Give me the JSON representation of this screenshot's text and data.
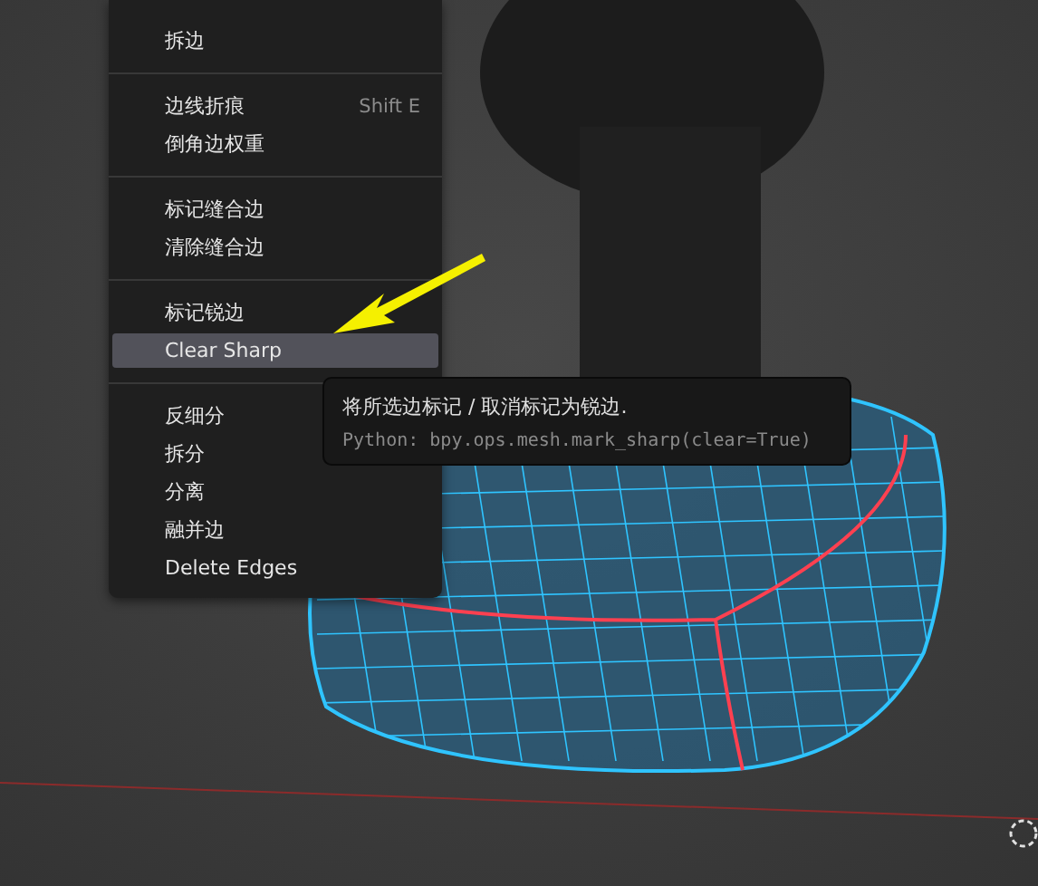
{
  "menu": {
    "items": [
      {
        "kind": "item",
        "label": "拆边",
        "selected": false
      },
      {
        "kind": "separator"
      },
      {
        "kind": "item",
        "label": "边线折痕",
        "shortcut": "Shift E",
        "selected": false
      },
      {
        "kind": "item",
        "label": "倒角边权重",
        "selected": false
      },
      {
        "kind": "separator"
      },
      {
        "kind": "item",
        "label": "标记缝合边",
        "selected": false
      },
      {
        "kind": "item",
        "label": "清除缝合边",
        "selected": false
      },
      {
        "kind": "separator"
      },
      {
        "kind": "item",
        "label": "标记锐边",
        "selected": false
      },
      {
        "kind": "item",
        "label": "Clear Sharp",
        "selected": true
      },
      {
        "kind": "separator"
      },
      {
        "kind": "item",
        "label": "反细分",
        "selected": false
      },
      {
        "kind": "item",
        "label": "拆分",
        "selected": false
      },
      {
        "kind": "item",
        "label": "分离",
        "selected": false
      },
      {
        "kind": "item",
        "label": "融并边",
        "selected": false
      },
      {
        "kind": "item",
        "label": "Delete Edges",
        "selected": false
      }
    ]
  },
  "tooltip": {
    "description": "将所选边标记 / 取消标记为锐边.",
    "python": "Python: bpy.ops.mesh.mark_sharp(clear=True)"
  }
}
